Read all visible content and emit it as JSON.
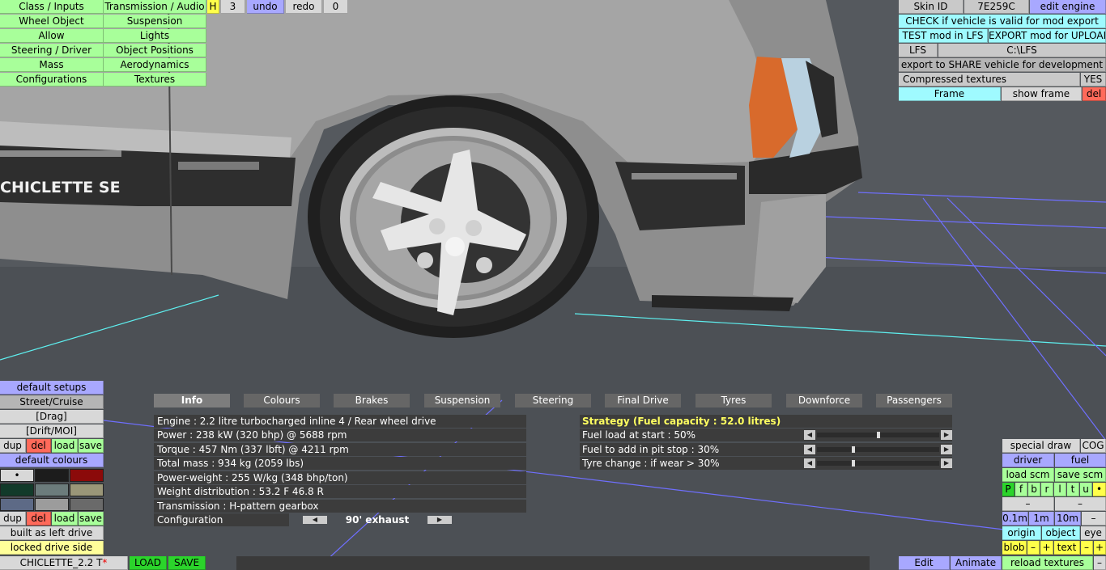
{
  "top_menu": {
    "class_inputs": "Class / Inputs",
    "transmission_audio": "Transmission / Audio",
    "h": "H",
    "three": "3",
    "undo": "undo",
    "redo": "redo",
    "zero": "0",
    "wheel_object": "Wheel Object",
    "suspension": "Suspension",
    "allow": "Allow",
    "lights": "Lights",
    "steering_driver": "Steering / Driver",
    "object_positions": "Object Positions",
    "mass": "Mass",
    "aerodynamics": "Aerodynamics",
    "configurations": "Configurations",
    "textures": "Textures"
  },
  "right_panel": {
    "skin_id_label": "Skin ID",
    "skin_id_value": "7E259C",
    "edit_engine": "edit engine",
    "check_valid": "CHECK if vehicle is valid for mod export",
    "test_mod": "TEST mod in LFS",
    "export_mod": "EXPORT mod for UPLOAD",
    "lfs": "LFS",
    "lfs_path": "C:\\LFS",
    "export_share": "export to SHARE vehicle for development",
    "compressed_textures": "Compressed textures",
    "compressed_value": "YES",
    "frame": "Frame",
    "show_frame": "show frame",
    "del": "del"
  },
  "left_panel": {
    "default_setups": "default setups",
    "street_cruise": "Street/Cruise",
    "drag": "[Drag]",
    "drift_moi": "[Drift/MOI]",
    "dup": "dup",
    "del": "del",
    "load": "load",
    "save": "save",
    "default_colours": "default colours",
    "dot": "•",
    "dup2": "dup",
    "del2": "del",
    "load2": "load",
    "save2": "save",
    "built_as_left": "built as left drive",
    "locked_drive_side": "locked drive side",
    "car_name": "CHICLETTE_2.2 T",
    "car_mark": "*",
    "load_btn": "LOAD",
    "save_btn": "SAVE"
  },
  "swatch_colors": [
    "#d8d8d8",
    "#1c1c1c",
    "#8b0a0a",
    "#123a2a",
    "#6c7c7c",
    "#9a9678",
    "#5d6a86",
    "#9c9c9c",
    "#6a6a6a"
  ],
  "tabs": [
    "Info",
    "Colours",
    "Brakes",
    "Suspension",
    "Steering",
    "Final Drive",
    "Tyres",
    "Downforce",
    "Passengers"
  ],
  "info": {
    "engine": "Engine : 2.2 litre turbocharged inline 4 / Rear wheel drive",
    "power": "Power : 238 kW (320 bhp) @ 5688 rpm",
    "torque": "Torque : 457 Nm (337 lbft) @ 4211 rpm",
    "total_mass": "Total mass : 934 kg (2059 lbs)",
    "power_weight": "Power-weight : 255 W/kg (348 bhp/ton)",
    "weight_dist": "Weight distribution : 53.2 F  46.8 R",
    "transmission": "Transmission : H-pattern gearbox",
    "configuration_label": "Configuration",
    "configuration_value": "90' exhaust"
  },
  "strategy": {
    "title": "Strategy (Fuel capacity : 52.0 litres)",
    "fuel_load": "Fuel load at start : 50%",
    "fuel_load_level": 0.5,
    "fuel_pit": "Fuel to add in pit stop : 30%",
    "fuel_pit_level": 0.3,
    "tyre_change": "Tyre change : if wear > 30%",
    "tyre_change_level": 0.3
  },
  "bottom_right": {
    "special_draw": "special draw",
    "cog": "COG",
    "driver": "driver",
    "fuel": "fuel",
    "load_scm": "load scm",
    "save_scm": "save scm",
    "flags": [
      "P",
      "f",
      "b",
      "r",
      "l",
      "t",
      "u",
      "•"
    ],
    "minus1": "–",
    "minus2": "–",
    "d01": "0.1m",
    "d1": "1m",
    "d10": "10m",
    "dminus": "–",
    "origin": "origin",
    "object": "object",
    "eye": "eye",
    "blob": "blob",
    "blob_minus": "–",
    "blob_plus": "+",
    "text": "text",
    "text_minus": "–",
    "text_plus": "+",
    "edit": "Edit",
    "animate": "Animate",
    "reload_textures": "reload textures",
    "end_minus": "–"
  },
  "car_badge": "CHICLETTE SE",
  "colors": {
    "green": "#a8ff9a",
    "cyan": "#9ffaff",
    "blue": "#a8a8ff",
    "strategy_yellow": "#ffff60"
  }
}
